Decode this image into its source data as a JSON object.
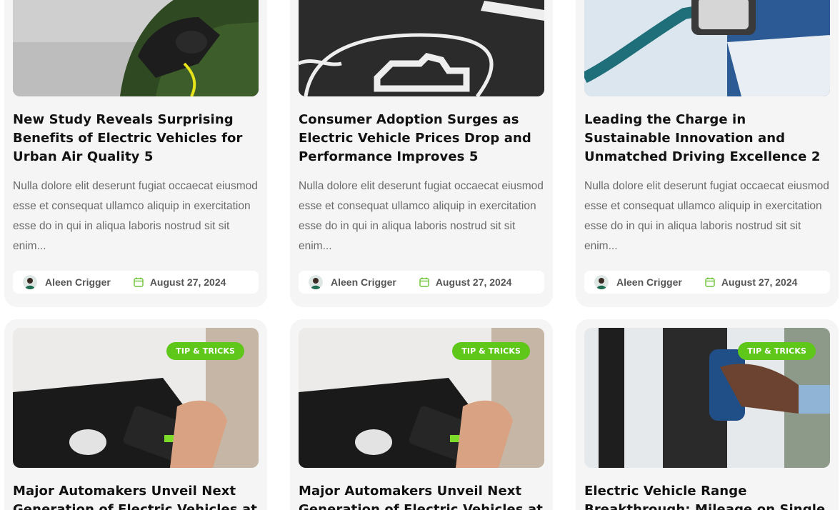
{
  "posts": [
    {
      "title": "New Study Reveals Surprising Benefits of Electric Vehicles for Urban Air Quality 5",
      "excerpt": "Nulla dolore elit deserunt fugiat occaecat eiusmod esse et consequat ullamco aliquip in exercitation esse do in qui in aliqua laboris nostrud sit sit enim...",
      "author": "Aleen Crigger",
      "date": "August 27, 2024",
      "image": "ev-charging-green-car"
    },
    {
      "title": "Consumer Adoption Surges as Electric Vehicle Prices Drop and Performance Improves 5",
      "excerpt": "Nulla dolore elit deserunt fugiat occaecat eiusmod esse et consequat ullamco aliquip in exercitation esse do in qui in aliqua laboris nostrud sit sit enim...",
      "author": "Aleen Crigger",
      "date": "August 27, 2024",
      "image": "ev-parking-sign-asphalt"
    },
    {
      "title": "Leading the Charge in Sustainable Innovation and Unmatched Driving Excellence 2",
      "excerpt": "Nulla dolore elit deserunt fugiat occaecat eiusmod esse et consequat ullamco aliquip in exercitation esse do in qui in aliqua laboris nostrud sit sit enim...",
      "author": "Aleen Crigger",
      "date": "August 27, 2024",
      "image": "ev-charging-cable-blue"
    },
    {
      "badge": "TIP & TRICKS",
      "title": "Major Automakers Unveil Next Generation of Electric Vehicles at",
      "image": "phone-app-charging"
    },
    {
      "badge": "TIP & TRICKS",
      "title": "Major Automakers Unveil Next Generation of Electric Vehicles at",
      "image": "phone-app-charging"
    },
    {
      "badge": "TIP & TRICKS",
      "title": "Electric Vehicle Range Breakthrough: Mileage on Single",
      "image": "hand-holding-charger"
    }
  ],
  "colors": {
    "accent": "#5fc61a",
    "card_bg": "#f5f5f6",
    "title": "#111111",
    "text": "#6a6a6a"
  }
}
